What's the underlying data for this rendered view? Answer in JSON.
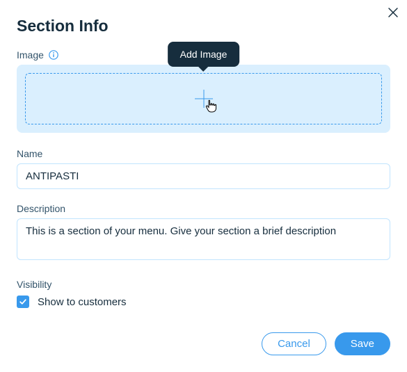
{
  "header": {
    "title": "Section Info",
    "tooltip": "Add Image"
  },
  "fields": {
    "image_label": "Image",
    "name_label": "Name",
    "name_value": "ANTIPASTI",
    "description_label": "Description",
    "description_value": "This is a section of your menu. Give your section a brief description",
    "visibility_label": "Visibility",
    "visibility_checkbox_label": "Show to customers",
    "visibility_checked": true
  },
  "buttons": {
    "cancel": "Cancel",
    "save": "Save"
  }
}
